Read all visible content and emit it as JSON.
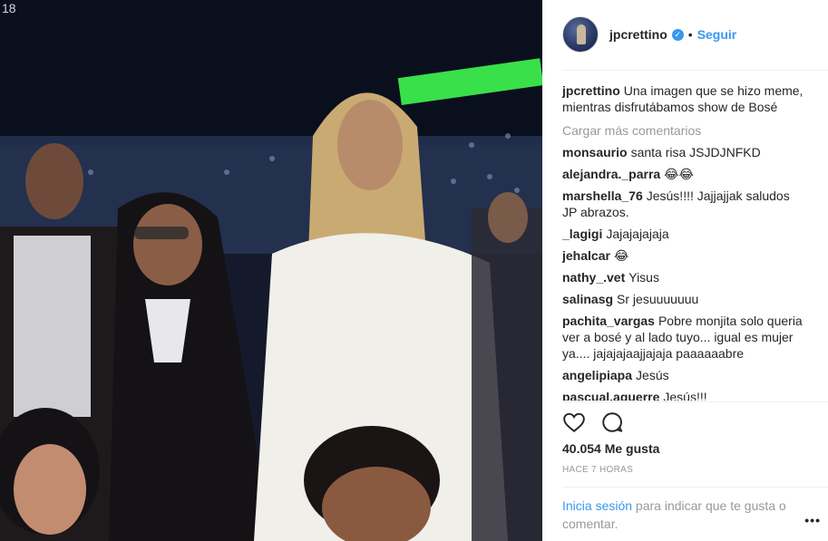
{
  "post": {
    "username": "jpcrettino",
    "verified_icon": "verified-badge-icon",
    "separator": "•",
    "follow_label": "Seguir",
    "caption_user": "jpcrettino",
    "caption_text": "Una imagen que se hizo meme, mientras disfrutábamos show de Bosé",
    "load_more_label": "Cargar más comentarios",
    "likes": "40.054 Me gusta",
    "time_ago": "HACE 7 HORAS",
    "login_link": "Inicia sesión",
    "login_text": " para indicar que te gusta o comentar.",
    "more_icon": "more-options-icon",
    "more_glyph": "•••"
  },
  "comments": [
    {
      "user": "monsaurio",
      "text": "santa risa JSJDJNFKD"
    },
    {
      "user": "alejandra._parra",
      "text": "😂😂"
    },
    {
      "user": "marshella_76",
      "text": "Jesús!!!! Jajjajjak saludos JP abrazos."
    },
    {
      "user": "_lagigi",
      "text": "Jajajajajaja"
    },
    {
      "user": "jehalcar",
      "text": "😂"
    },
    {
      "user": "nathy_.vet",
      "text": "Yisus"
    },
    {
      "user": "salinasg",
      "text": "Sr jesuuuuuuu"
    },
    {
      "user": "pachita_vargas",
      "text": "Pobre monjita solo queria ver a bosé y al lado tuyo... igual es mujer ya.... jajajajaajjajaja paaaaaabre"
    },
    {
      "user": "angelipiapa",
      "text": "Jesús"
    },
    {
      "user": "pascual.aguerre",
      "text": "Jesús!!!"
    }
  ],
  "colors": {
    "link": "#3897f0",
    "text": "#262626",
    "muted": "#999999",
    "divider": "#efefef"
  },
  "photo": {
    "overlay_text": "18"
  }
}
